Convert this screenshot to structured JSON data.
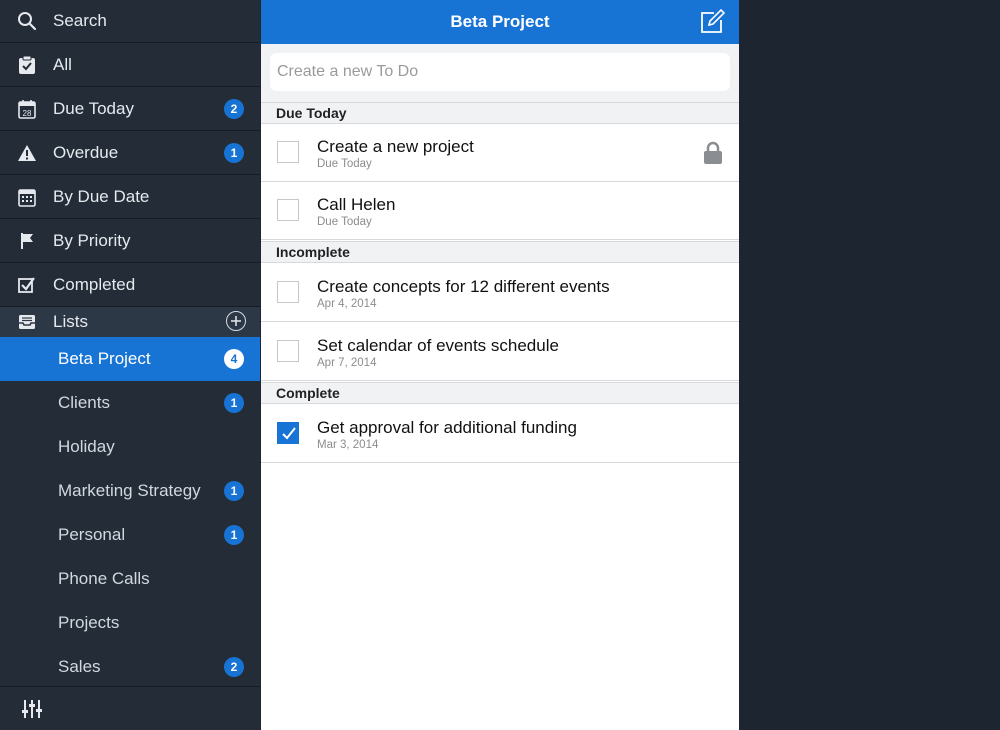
{
  "sidebar": {
    "search_label": "Search",
    "items": [
      {
        "label": "All",
        "icon": "checklist-icon"
      },
      {
        "label": "Due Today",
        "icon": "calendar-28-icon",
        "badge": "2",
        "calendar_day": "28"
      },
      {
        "label": "Overdue",
        "icon": "warning-icon",
        "badge": "1"
      },
      {
        "label": "By Due Date",
        "icon": "calendar-icon"
      },
      {
        "label": "By Priority",
        "icon": "flag-icon"
      },
      {
        "label": "Completed",
        "icon": "checkbox-checked-icon"
      }
    ],
    "lists_label": "Lists",
    "lists": [
      {
        "label": "Beta Project",
        "badge": "4",
        "active": true
      },
      {
        "label": "Clients",
        "badge": "1"
      },
      {
        "label": "Holiday"
      },
      {
        "label": "Marketing Strategy",
        "badge": "1"
      },
      {
        "label": "Personal",
        "badge": "1"
      },
      {
        "label": "Phone Calls"
      },
      {
        "label": "Projects"
      },
      {
        "label": "Sales",
        "badge": "2"
      }
    ]
  },
  "main": {
    "title": "Beta Project",
    "new_todo_placeholder": "Create a new To Do",
    "sections": [
      {
        "label": "Due Today",
        "tasks": [
          {
            "title": "Create a new project",
            "subtitle": "Due Today",
            "done": false,
            "locked": true
          },
          {
            "title": "Call Helen",
            "subtitle": "Due Today",
            "done": false
          }
        ]
      },
      {
        "label": "Incomplete",
        "tasks": [
          {
            "title": "Create concepts for 12 different events",
            "subtitle": "Apr 4, 2014",
            "done": false
          },
          {
            "title": "Set calendar of events schedule",
            "subtitle": "Apr 7, 2014",
            "done": false
          }
        ]
      },
      {
        "label": "Complete",
        "tasks": [
          {
            "title": "Get approval for additional funding",
            "subtitle": "Mar 3, 2014",
            "done": true
          }
        ]
      }
    ]
  },
  "colors": {
    "accent": "#1773d4",
    "sidebar_bg": "#232c37",
    "background": "#1c2530"
  }
}
